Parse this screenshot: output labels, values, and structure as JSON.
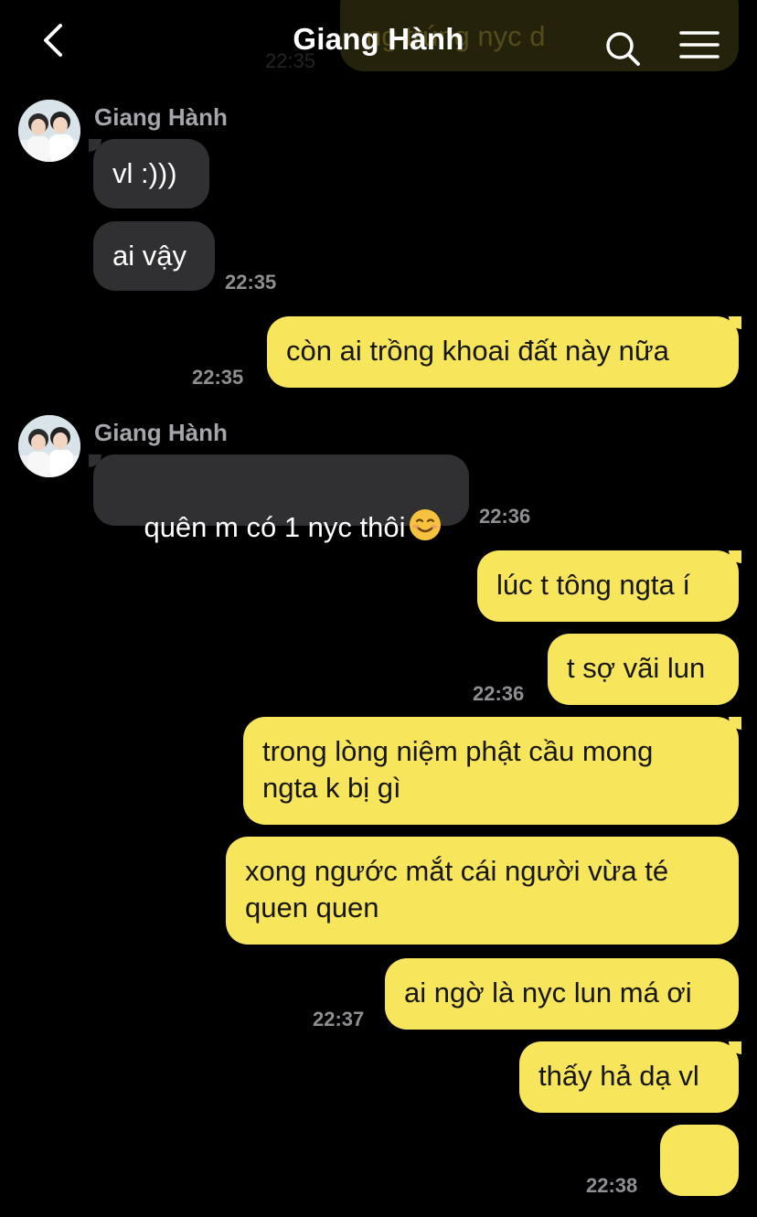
{
  "header": {
    "title": "Giang Hành"
  },
  "scrolled_top": {
    "partial_text": "ng trúng nyc d",
    "time": "22:35"
  },
  "messages": [
    {
      "sender": "Giang Hành",
      "text": "vl :)))"
    },
    {
      "text": "ai vậy",
      "time": "22:35"
    },
    {
      "text": "còn ai trồng khoai đất này nữa",
      "time": "22:35"
    },
    {
      "sender": "Giang Hành",
      "text": "quên m có 1 nyc thôi",
      "emoji": "☺️",
      "time": "22:36"
    },
    {
      "text": "lúc t tông ngta í"
    },
    {
      "text": "t sợ vãi lun",
      "time": "22:36"
    },
    {
      "text": "trong lòng niệm phật cầu mong\nngta k bị gì"
    },
    {
      "text": "xong ngước mắt cái người vừa té\nquen quen"
    },
    {
      "text": "ai ngờ là nyc lun má ơi",
      "time": "22:37"
    },
    {
      "text": "thấy hả dạ vl"
    },
    {
      "emoji": "😋",
      "time": "22:38"
    }
  ],
  "colors": {
    "background": "#000000",
    "incoming_bubble": "#303033",
    "outgoing_bubble": "#f7e55c",
    "timestamp": "#8e8e93"
  },
  "icons": {
    "back": "chevron-left-icon",
    "search": "search-icon",
    "menu": "hamburger-menu-icon"
  }
}
